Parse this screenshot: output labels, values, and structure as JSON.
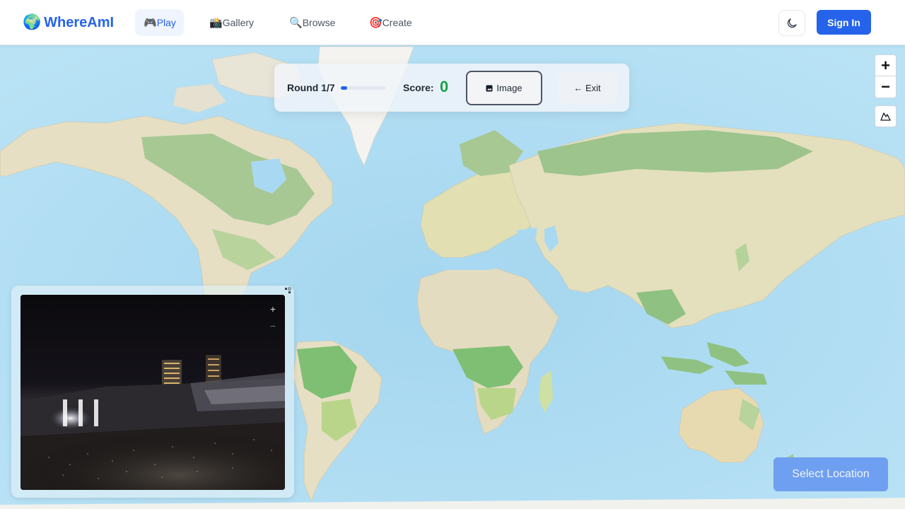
{
  "app": {
    "name": "WhereAmI",
    "logo_icon": "globe-icon",
    "accent": "#2563eb"
  },
  "nav": {
    "items": [
      {
        "label": "Play",
        "icon": "gamepad-icon",
        "glyph": "🎮",
        "active": true
      },
      {
        "label": "Gallery",
        "icon": "camera-icon",
        "glyph": "📸",
        "active": false
      },
      {
        "label": "Browse",
        "icon": "magnifier-icon",
        "glyph": "🔍",
        "active": false
      },
      {
        "label": "Create",
        "icon": "target-icon",
        "glyph": "🎯",
        "active": false
      }
    ],
    "theme_toggle_icon": "moon-icon",
    "sign_in_label": "Sign In"
  },
  "game": {
    "round_label": "Round 1/7",
    "round_current": 1,
    "round_total": 7,
    "progress_fraction": 0.14,
    "score_label": "Score:",
    "score_value": "0",
    "score_color": "#16a34a",
    "image_button_label": "Image",
    "exit_button_label": "← Exit"
  },
  "map_controls": {
    "zoom_in": "+",
    "zoom_out": "−",
    "terrain_icon": "mountain-icon"
  },
  "photo_viewer": {
    "zoom_in": "+",
    "zoom_out": "−",
    "expand_icon": "expand-icon"
  },
  "select_location_label": "Select Location",
  "colors": {
    "ocean": "#a9d9f2",
    "land": "#e6dfc4",
    "forest": "#9cc48c",
    "select_button": "#6f9ff0"
  }
}
